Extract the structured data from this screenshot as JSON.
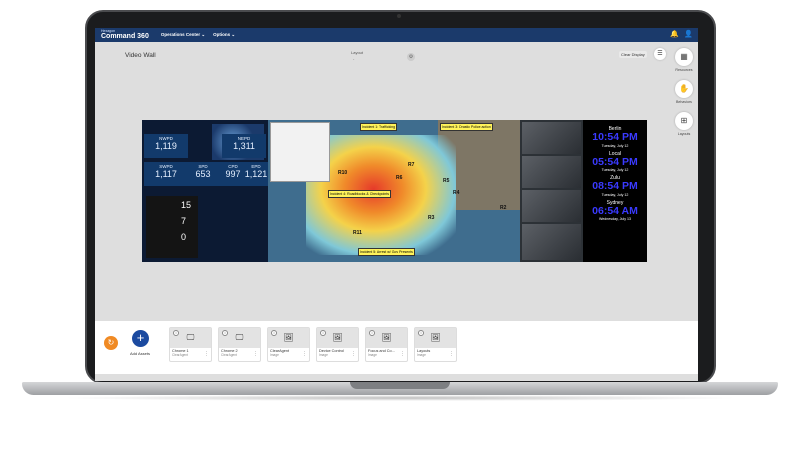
{
  "app": {
    "brand_small": "Hexagon",
    "brand_big": "Command 360"
  },
  "topbar": {
    "menu1": "Operations Center ⌄",
    "menu2": "Options ⌄",
    "bell_icon": "bell",
    "user_icon": "user"
  },
  "page": {
    "title": "Video Wall",
    "layout_label": "Layout",
    "layout_value": "-",
    "clear_display": "Clear Display"
  },
  "rail": [
    {
      "label": "Resources",
      "icon": "resources-icon"
    },
    {
      "label": "Behaviors",
      "icon": "behaviors-icon"
    },
    {
      "label": "Layouts",
      "icon": "layouts-icon"
    }
  ],
  "stats": [
    {
      "label": "NWPD",
      "value": "1,119"
    },
    {
      "label": "NEPD",
      "value": "1,311"
    },
    {
      "label": "SWPD",
      "value": "1,117"
    },
    {
      "label": "SPD",
      "value": "653"
    },
    {
      "label": "CPD",
      "value": "997"
    },
    {
      "label": "EPD",
      "value": "1,121"
    }
  ],
  "gauge_numbers": [
    "15",
    "7",
    "0"
  ],
  "map": {
    "regions": [
      "R10",
      "R7",
      "R6",
      "R5",
      "R4",
      "R3",
      "R2",
      "R11"
    ],
    "callouts": [
      "Incident 1: Trafficking",
      "Incident 3: Drastic Police action",
      "Incident 4: Roadblocks & Checkpoints",
      "Incident 5: Arrest w/ Gov Presents"
    ]
  },
  "clocks": [
    {
      "city": "Berlin",
      "time": "10:54 PM",
      "date": "Tuesday, July 12"
    },
    {
      "city": "Local",
      "time": "05:54 PM",
      "date": "Tuesday, July 12"
    },
    {
      "city": "Zulu",
      "time": "08:54 PM",
      "date": "Tuesday, July 12"
    },
    {
      "city": "Sydney",
      "time": "06:54 AM",
      "date": "Wednesday, July 13"
    }
  ],
  "assets": {
    "add_label": "Add Assets",
    "cards": [
      {
        "name": "Chrome 1",
        "type": "ClearAgent",
        "icon": "display-icon"
      },
      {
        "name": "Chrome 2",
        "type": "ClearAgent",
        "icon": "display-icon"
      },
      {
        "name": "ClearAgent",
        "type": "Image",
        "icon": "image-icon"
      },
      {
        "name": "Device Control",
        "type": "Image",
        "icon": "image-icon"
      },
      {
        "name": "Focus and Co...",
        "type": "Image",
        "icon": "image-icon"
      },
      {
        "name": "Layouts",
        "type": "Image",
        "icon": "image-icon"
      }
    ]
  }
}
